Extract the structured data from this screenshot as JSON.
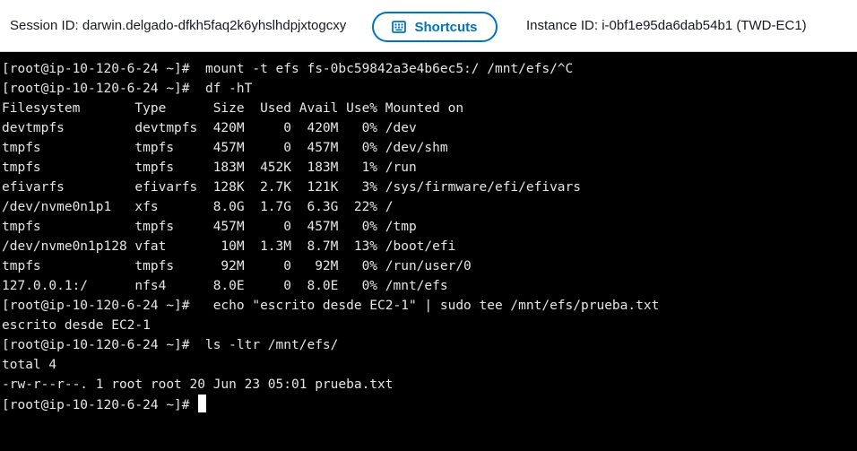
{
  "header": {
    "session_text": "Session ID: darwin.delgado-dfkh5faq2k6yhslhdpjxtogcxy",
    "shortcuts_label": "Shortcuts",
    "shortcuts_icon": "keyboard-icon",
    "instance_text": "Instance ID: i-0bf1e95da6dab54b1 (TWD-EC1)",
    "accent_color": "#0073bb"
  },
  "terminal": {
    "lines": [
      "[root@ip-10-120-6-24 ~]#  mount -t efs fs-0bc59842a3e4b6ec5:/ /mnt/efs/^C",
      "[root@ip-10-120-6-24 ~]#  df -hT",
      "Filesystem       Type      Size  Used Avail Use% Mounted on",
      "devtmpfs         devtmpfs  420M     0  420M   0% /dev",
      "tmpfs            tmpfs     457M     0  457M   0% /dev/shm",
      "tmpfs            tmpfs     183M  452K  183M   1% /run",
      "efivarfs         efivarfs  128K  2.7K  121K   3% /sys/firmware/efi/efivars",
      "/dev/nvme0n1p1   xfs       8.0G  1.7G  6.3G  22% /",
      "tmpfs            tmpfs     457M     0  457M   0% /tmp",
      "/dev/nvme0n1p128 vfat       10M  1.3M  8.7M  13% /boot/efi",
      "tmpfs            tmpfs      92M     0   92M   0% /run/user/0",
      "127.0.0.1:/      nfs4      8.0E     0  8.0E   0% /mnt/efs",
      "[root@ip-10-120-6-24 ~]#   echo \"escrito desde EC2-1\" | sudo tee /mnt/efs/prueba.txt",
      "escrito desde EC2-1",
      "[root@ip-10-120-6-24 ~]#  ls -ltr /mnt/efs/",
      "total 4",
      "-rw-r--r--. 1 root root 20 Jun 23 05:01 prueba.txt"
    ],
    "prompt": "[root@ip-10-120-6-24 ~]# "
  }
}
